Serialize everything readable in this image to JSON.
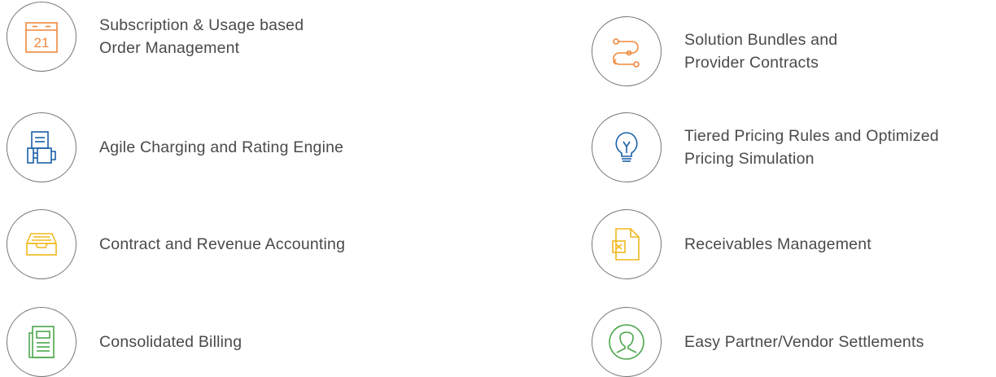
{
  "colors": {
    "orange": "#f0883c",
    "blue": "#1a5fa8",
    "yellow": "#f2b81c",
    "green": "#4aa64a",
    "circle_border": "#777777",
    "text": "#4a4a4a"
  },
  "features": [
    {
      "icon": "calendar-icon",
      "icon_text": "21",
      "lines": [
        "Subscription & Usage based",
        "Order Management"
      ]
    },
    {
      "icon": "charging-engine-icon",
      "lines": [
        "Agile Charging and Rating Engine"
      ]
    },
    {
      "icon": "inbox-tray-icon",
      "lines": [
        "Contract and Revenue Accounting"
      ]
    },
    {
      "icon": "bill-document-icon",
      "lines": [
        "Consolidated Billing"
      ]
    },
    {
      "icon": "flow-path-icon",
      "lines": [
        "Solution Bundles and",
        "Provider Contracts"
      ]
    },
    {
      "icon": "lightbulb-icon",
      "lines": [
        "Tiered Pricing Rules and Optimized",
        "Pricing Simulation"
      ]
    },
    {
      "icon": "spreadsheet-file-icon",
      "lines": [
        "Receivables Management"
      ]
    },
    {
      "icon": "user-avatar-icon",
      "lines": [
        "Easy Partner/Vendor Settlements"
      ]
    }
  ]
}
